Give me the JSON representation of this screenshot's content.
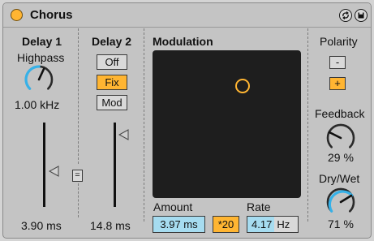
{
  "device": {
    "title": "Chorus",
    "active": true
  },
  "delay1": {
    "title": "Delay 1",
    "highpass_label": "Highpass",
    "highpass_value": "1.00 kHz",
    "time_value": "3.90 ms",
    "link_label": "="
  },
  "delay2": {
    "title": "Delay 2",
    "modes": [
      "Off",
      "Fix",
      "Mod"
    ],
    "selected_mode": "Fix",
    "time_value": "14.8 ms"
  },
  "modulation": {
    "title": "Modulation",
    "amount_label": "Amount",
    "amount_value": "3.97 ms",
    "x20_label": "*20",
    "rate_label": "Rate",
    "rate_value": "4.17",
    "rate_unit": "Hz"
  },
  "polarity": {
    "title": "Polarity",
    "minus_label": "-",
    "plus_label": "+",
    "selected": "+"
  },
  "feedback": {
    "label": "Feedback",
    "value": "29 %"
  },
  "dry_wet": {
    "label": "Dry/Wet",
    "value": "71 %"
  },
  "colors": {
    "accent": "#ffb532",
    "value_field": "#a6dcf0",
    "knob_arc": "#36b1e8",
    "panel": "#c4c4c4",
    "xy_background": "#1e1e1e"
  },
  "icons": {
    "power": "device-power-icon",
    "hot_swap": "hot-swap-icon",
    "save": "save-preset-icon"
  }
}
